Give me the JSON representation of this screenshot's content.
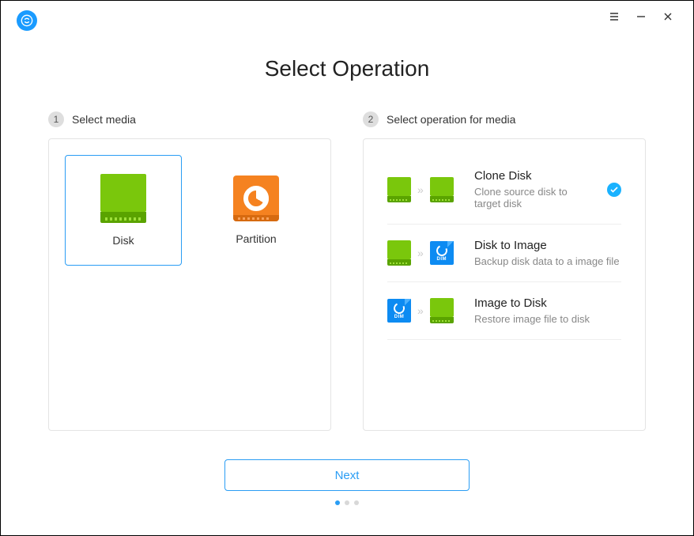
{
  "title": "Select Operation",
  "step1": {
    "num": "1",
    "label": "Select media"
  },
  "step2": {
    "num": "2",
    "label": "Select operation for media"
  },
  "media": {
    "disk": "Disk",
    "partition": "Partition"
  },
  "ops": [
    {
      "title": "Clone Disk",
      "desc": "Clone source disk to target disk",
      "selected": true
    },
    {
      "title": "Disk to Image",
      "desc": "Backup disk data to a image file",
      "selected": false
    },
    {
      "title": "Image to Disk",
      "desc": "Restore image file to disk",
      "selected": false
    }
  ],
  "next": "Next",
  "pager": {
    "active": 0,
    "total": 3
  }
}
